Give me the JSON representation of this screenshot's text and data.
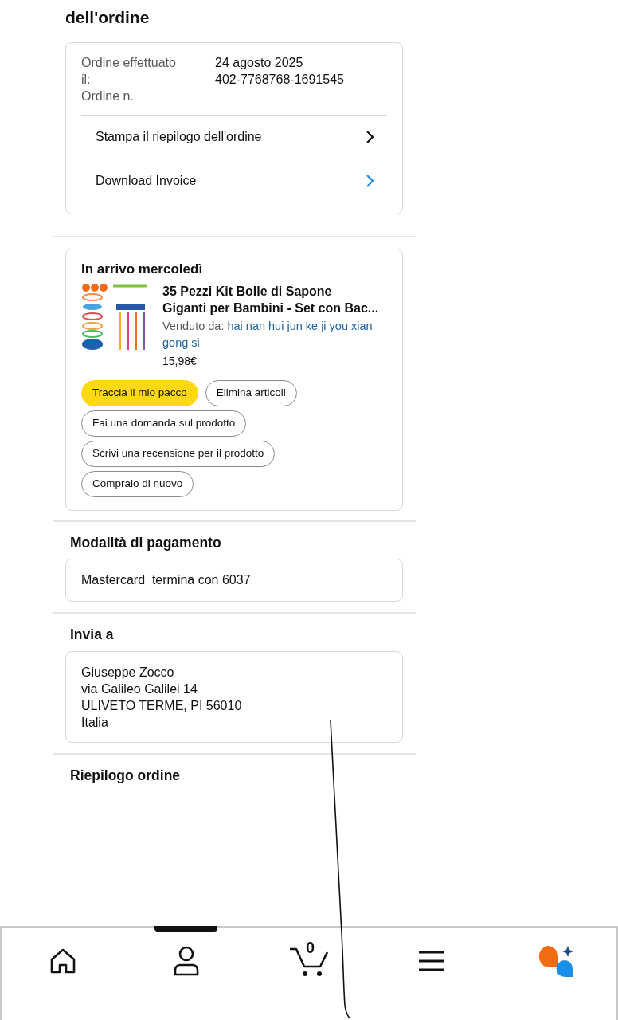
{
  "page_title": "dell'ordine",
  "order_info": {
    "labels": [
      "Ordine effettuato il:",
      "Ordine n."
    ],
    "values": [
      "24 agosto 2025",
      "402-7768768-1691545"
    ]
  },
  "order_links": [
    {
      "label": "Stampa il riepilogo dell'ordine",
      "kind": "plain"
    },
    {
      "label": "Download Invoice",
      "kind": "accent"
    }
  ],
  "shipment": {
    "heading": "In arrivo mercoledì",
    "product": {
      "title": "35 Pezzi Kit Bolle di Sapone Giganti per Bambini - Set con Bac...",
      "sold_by_label": "Venduto da:",
      "seller": "hai nan hui jun ke ji you xian gong si",
      "price": "15,98€"
    },
    "actions": [
      {
        "label": "Traccia il mio pacco",
        "kind": "primary"
      },
      {
        "label": "Elimina articoli",
        "kind": "secondary"
      },
      {
        "label": "Fai una domanda sul prodotto",
        "kind": "secondary"
      },
      {
        "label": "Scrivi una recensione per il prodotto",
        "kind": "secondary"
      },
      {
        "label": "Compralo di nuovo",
        "kind": "secondary"
      }
    ]
  },
  "payment": {
    "heading": "Modalità di pagamento",
    "method": "Mastercard  termina con 6037"
  },
  "shipping": {
    "heading": "Invia a",
    "address_lines": [
      "Giuseppe Zocco",
      "via Galileo Galilei 14",
      "ULIVETO TERME, PI 56010",
      "Italia"
    ]
  },
  "summary": {
    "heading": "Riepilogo ordine"
  },
  "bottom_nav": [
    {
      "kind": "home",
      "selected": false
    },
    {
      "kind": "account",
      "selected": true
    },
    {
      "kind": "cart",
      "badge": "0",
      "selected": false
    },
    {
      "kind": "menu",
      "selected": false
    },
    {
      "kind": "assistant",
      "selected": false
    }
  ]
}
